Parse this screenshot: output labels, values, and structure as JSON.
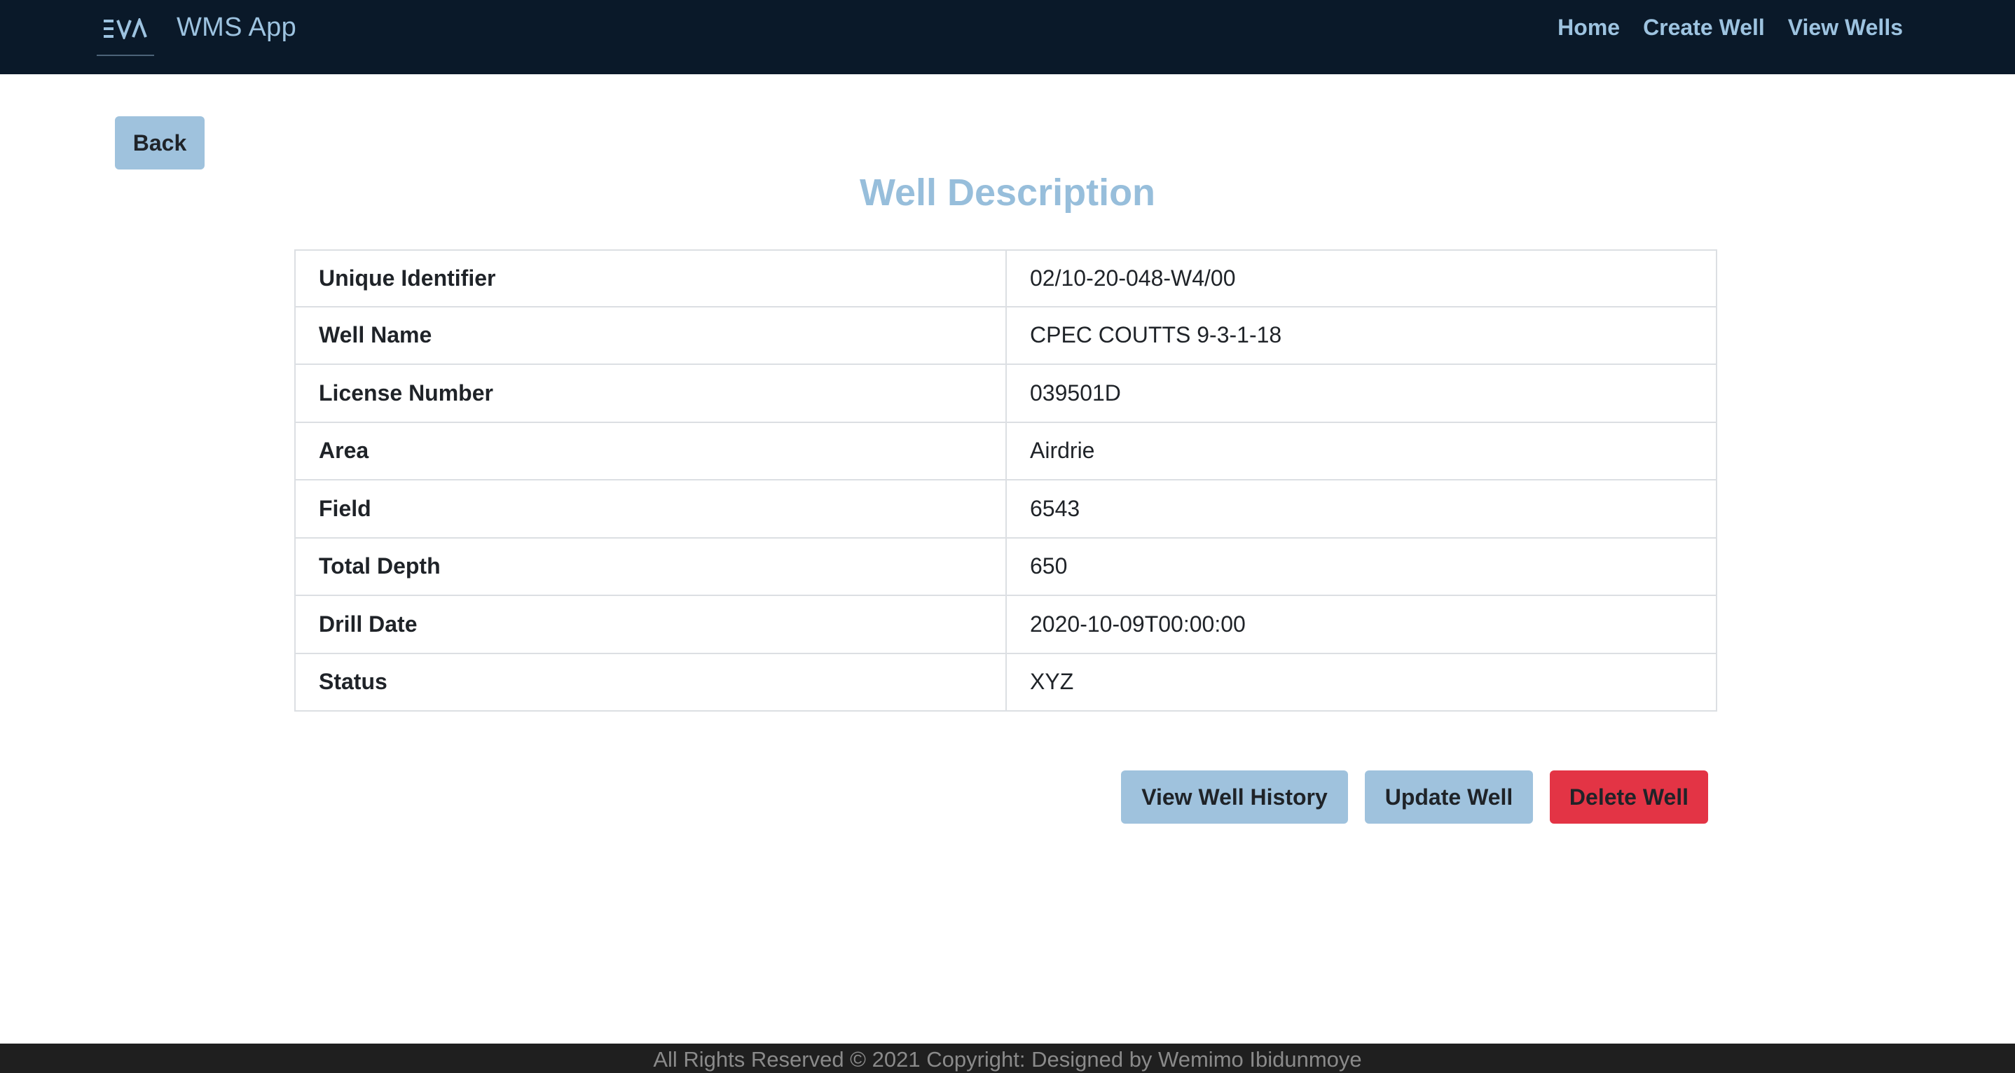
{
  "navbar": {
    "logo_text": "EVA",
    "brand": "WMS App",
    "links": [
      "Home",
      "Create Well",
      "View Wells"
    ]
  },
  "back_label": "Back",
  "title": "Well Description",
  "details": [
    {
      "label": "Unique Identifier",
      "value": "02/10-20-048-W4/00"
    },
    {
      "label": "Well Name",
      "value": "CPEC COUTTS 9-3-1-18"
    },
    {
      "label": "License Number",
      "value": "039501D"
    },
    {
      "label": "Area",
      "value": "Airdrie"
    },
    {
      "label": "Field",
      "value": "6543"
    },
    {
      "label": "Total Depth",
      "value": "650"
    },
    {
      "label": "Drill Date",
      "value": "2020-10-09T00:00:00"
    },
    {
      "label": "Status",
      "value": "XYZ"
    }
  ],
  "actions": {
    "history_label": "View Well History",
    "update_label": "Update Well",
    "delete_label": "Delete Well"
  },
  "footer": "All Rights Reserved © 2021 Copyright: Designed by Wemimo Ibidunmoye",
  "colors": {
    "navbar_bg": "#0a1929",
    "accent": "#9fc2dd",
    "danger": "#e33445",
    "footer_bg": "#1f1f1f"
  }
}
